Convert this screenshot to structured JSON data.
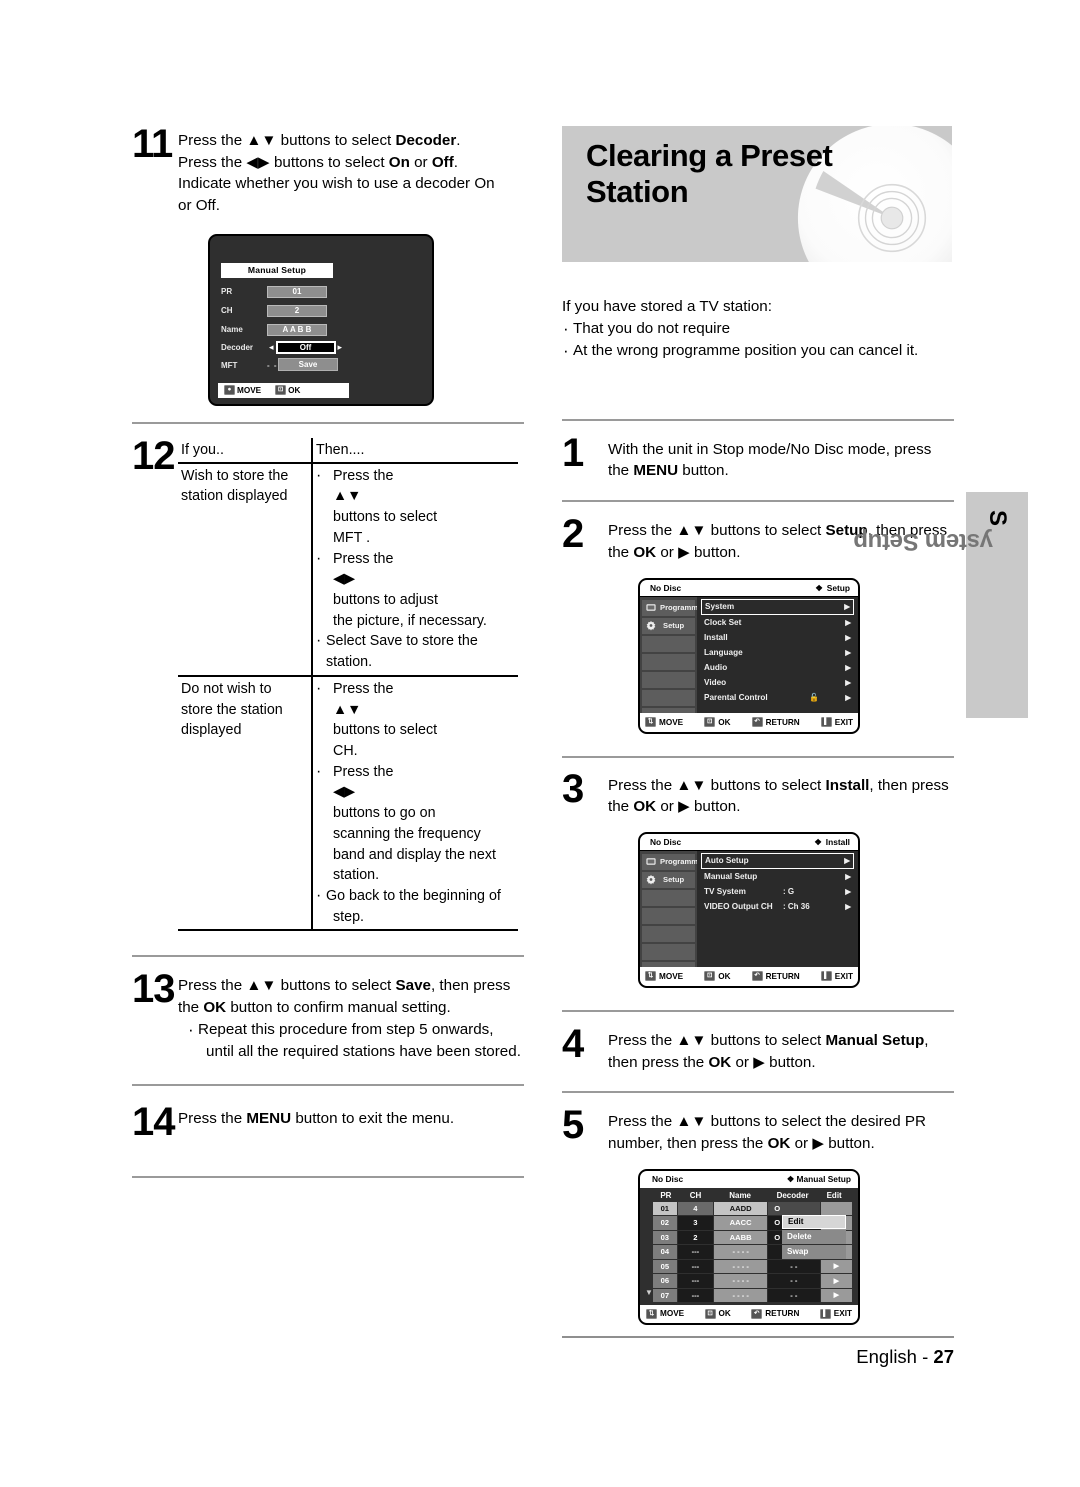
{
  "page": {
    "footer_label": "English - ",
    "footer_page": "27"
  },
  "side_tab": {
    "first_letter": "S",
    "rest": "ystem Setup"
  },
  "left_column": {
    "step11": {
      "number": "11",
      "line1_a": "Press the ",
      "line1_arrows": "▲▼",
      "line1_b": " buttons to select ",
      "line1_bold": "Decoder",
      "line1_c": ".",
      "line2_a": "Press the ",
      "line2_arrows": "◀▶",
      "line2_b": " buttons to select ",
      "line2_bold1": "On",
      "line2_mid": " or ",
      "line2_bold2": "Off",
      "line2_c": ".",
      "line3": "Indicate whether you wish to use a decoder On",
      "line4": "or Off."
    },
    "manual_setup_osd": {
      "title": "Manual Setup",
      "rows": [
        {
          "label": "PR",
          "value": "01"
        },
        {
          "label": "CH",
          "value": "2"
        },
        {
          "label": "Name",
          "value": "A A B B"
        },
        {
          "label": "Decoder",
          "value": "Off"
        }
      ],
      "mft_label": "MFT",
      "mft_value": "- - - ❙ - - -",
      "save_label": "Save",
      "footer": [
        {
          "icon": "dpad-icon",
          "label": "MOVE"
        },
        {
          "icon": "ok-key-icon",
          "label": "OK"
        }
      ]
    },
    "step12": {
      "number": "12",
      "header_if": "If you..",
      "header_then": "Then....",
      "rows": [
        {
          "if": "Wish to store the station displayed",
          "then": [
            {
              "a": "Press the ",
              "arrows": "▲▼",
              "b": " buttons to select",
              "cont": "MFT ."
            },
            {
              "a": "Press the ",
              "arrows": "◀▶",
              "b": " buttons to adjust",
              "cont": "the picture, if necessary."
            },
            {
              "a": "Select Save to store the station.",
              "arrows": "",
              "b": "",
              "cont": ""
            }
          ]
        },
        {
          "if": "Do not wish to store the station displayed",
          "then": [
            {
              "a": "Press the ",
              "arrows": "▲▼",
              "b": " buttons to select",
              "cont": "CH."
            },
            {
              "a": "Press the ",
              "arrows": "◀▶",
              "b": " buttons to go on",
              "cont": "scanning the frequency band and display the next station."
            },
            {
              "a": "Go back to the beginning of",
              "arrows": "",
              "b": "",
              "cont": "step."
            }
          ]
        }
      ]
    },
    "step13": {
      "number": "13",
      "line1_a": "Press the ",
      "line1_arrows": "▲▼",
      "line1_b": " buttons to select ",
      "line1_bold": "Save",
      "line1_c": ", then press",
      "line2_a": "the ",
      "line2_bold": "OK",
      "line2_b": " button to confirm manual setting.",
      "bullet1": "Repeat this procedure from step 5 onwards,",
      "bullet1_cont": "until all the required stations have been stored."
    },
    "step14": {
      "number": "14",
      "line_a": "Press the ",
      "line_bold": "MENU",
      "line_b": " button to exit the menu."
    }
  },
  "right_column": {
    "banner": {
      "title_line1": "Clearing a Preset",
      "title_line2": "Station"
    },
    "intro": {
      "lead": "If you have stored a TV station:",
      "bullets": [
        "That you do not require",
        "At the wrong programme position you can cancel it."
      ]
    },
    "step1": {
      "number": "1",
      "line1": "With the unit in Stop mode/No Disc mode, press",
      "line2_a": "the ",
      "line2_bold": "MENU",
      "line2_b": " button."
    },
    "step2": {
      "number": "2",
      "line1_a": "Press the ",
      "line1_arrows": "▲▼",
      "line1_b": " buttons to select ",
      "line1_bold": "Setup",
      "line1_c": ", then press",
      "line2_a": "the ",
      "line2_bold": "OK",
      "line2_mid": " or ",
      "line2_arrow": "▶",
      "line2_b": " button."
    },
    "setup_osd": {
      "status": "No Disc",
      "title": "Setup",
      "title_icon": "❖",
      "side": [
        {
          "label": "Programme",
          "icon": "tv-icon"
        },
        {
          "label": "Setup",
          "icon": "gear-icon"
        }
      ],
      "items": [
        {
          "name": "System",
          "value": "",
          "selected": true,
          "caret": "▶"
        },
        {
          "name": "Clock Set",
          "value": "",
          "selected": false,
          "caret": "▶"
        },
        {
          "name": "Install",
          "value": "",
          "selected": false,
          "caret": "▶"
        },
        {
          "name": "Language",
          "value": "",
          "selected": false,
          "caret": "▶"
        },
        {
          "name": "Audio",
          "value": "",
          "selected": false,
          "caret": "▶"
        },
        {
          "name": "Video",
          "value": "",
          "selected": false,
          "caret": "▶"
        },
        {
          "name": "Parental Control",
          "value": "🔓",
          "selected": false,
          "caret": "▶"
        }
      ],
      "footer": [
        {
          "icon": "updown-icon",
          "label": "MOVE"
        },
        {
          "icon": "ok-key-icon",
          "label": "OK"
        },
        {
          "icon": "return-icon",
          "label": "RETURN"
        },
        {
          "icon": "exit-icon",
          "label": "EXIT"
        }
      ]
    },
    "step3": {
      "number": "3",
      "line1_a": "Press the ",
      "line1_arrows": "▲▼",
      "line1_b": " buttons to select ",
      "line1_bold": "Install",
      "line1_c": ", then press",
      "line2_a": "the ",
      "line2_bold": "OK",
      "line2_mid": " or ",
      "line2_arrow": "▶",
      "line2_b": " button."
    },
    "install_osd": {
      "status": "No Disc",
      "title": "Install",
      "title_icon": "❖",
      "side": [
        {
          "label": "Programme",
          "icon": "tv-icon"
        },
        {
          "label": "Setup",
          "icon": "gear-icon"
        }
      ],
      "items": [
        {
          "name": "Auto Setup",
          "value": "",
          "selected": true,
          "caret": "▶"
        },
        {
          "name": "Manual Setup",
          "value": "",
          "selected": false,
          "caret": "▶"
        },
        {
          "name": "TV System",
          "value": ": G",
          "selected": false,
          "caret": "▶"
        },
        {
          "name": "VIDEO Output CH",
          "value": ": Ch 36",
          "selected": false,
          "caret": "▶"
        }
      ],
      "footer": [
        {
          "icon": "updown-icon",
          "label": "MOVE"
        },
        {
          "icon": "ok-key-icon",
          "label": "OK"
        },
        {
          "icon": "return-icon",
          "label": "RETURN"
        },
        {
          "icon": "exit-icon",
          "label": "EXIT"
        }
      ]
    },
    "step4": {
      "number": "4",
      "line1_a": "Press the ",
      "line1_arrows": "▲▼",
      "line1_b": " buttons to select ",
      "line1_bold": "Manual Setup",
      "line1_c": ",",
      "line2_a": "then press the ",
      "line2_bold": "OK",
      "line2_mid": " or ",
      "line2_arrow": "▶",
      "line2_b": " button."
    },
    "step5": {
      "number": "5",
      "line1_a": "Press the ",
      "line1_arrows": "▲▼",
      "line1_b": " buttons to select the desired PR",
      "line2_a": "number, then press the ",
      "line2_bold": "OK",
      "line2_mid": " or ",
      "line2_arrow": "▶",
      "line2_b": " button."
    },
    "manual_table_osd": {
      "status": "No Disc",
      "title": "Manual Setup",
      "title_icon": "❖",
      "columns": [
        "PR",
        "CH",
        "Name",
        "Decoder",
        "Edit"
      ],
      "rows": [
        {
          "pr": "01",
          "ch": "4",
          "name": "AADD",
          "decoder": "O",
          "edit": ""
        },
        {
          "pr": "02",
          "ch": "3",
          "name": "AACC",
          "decoder": "O",
          "edit": ""
        },
        {
          "pr": "03",
          "ch": "2",
          "name": "AABB",
          "decoder": "O",
          "edit": ""
        },
        {
          "pr": "04",
          "ch": "---",
          "name": "- - - -",
          "decoder": "- -",
          "edit": "▶"
        },
        {
          "pr": "05",
          "ch": "---",
          "name": "- - - -",
          "decoder": "- -",
          "edit": "▶"
        },
        {
          "pr": "06",
          "ch": "---",
          "name": "- - - -",
          "decoder": "- -",
          "edit": "▶"
        },
        {
          "pr": "07",
          "ch": "---",
          "name": "- - - -",
          "decoder": "- -",
          "edit": "▶"
        }
      ],
      "popup": [
        {
          "label": "Edit",
          "selected": true
        },
        {
          "label": "Delete",
          "selected": false
        },
        {
          "label": "Swap",
          "selected": false
        }
      ],
      "scroll_indicator": "▼",
      "footer": [
        {
          "icon": "updown-icon",
          "label": "MOVE"
        },
        {
          "icon": "ok-key-icon",
          "label": "OK"
        },
        {
          "icon": "return-icon",
          "label": "RETURN"
        },
        {
          "icon": "exit-icon",
          "label": "EXIT"
        }
      ]
    }
  }
}
